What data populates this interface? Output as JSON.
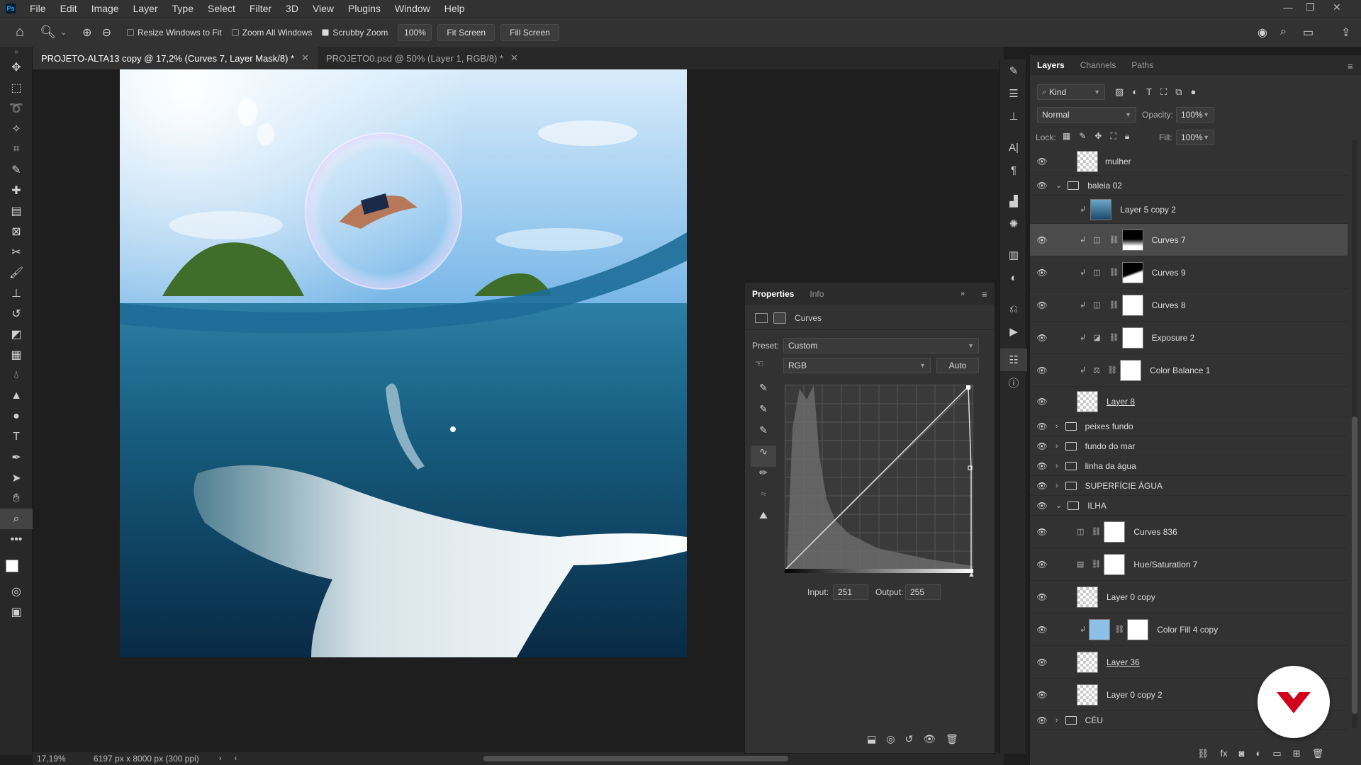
{
  "menu": {
    "app_logo": "Ps",
    "items": [
      "File",
      "Edit",
      "Image",
      "Layer",
      "Type",
      "Select",
      "Filter",
      "3D",
      "View",
      "Plugins",
      "Window",
      "Help"
    ]
  },
  "options": {
    "resize_windows": "Resize Windows to Fit",
    "zoom_all": "Zoom All Windows",
    "scrubby_zoom": "Scrubby Zoom",
    "zoom_value": "100%",
    "fit_screen": "Fit Screen",
    "fill_screen": "Fill Screen"
  },
  "tabs": [
    {
      "label": "PROJETO-ALTA13 copy @ 17,2% (Curves 7, Layer Mask/8) *",
      "active": true
    },
    {
      "label": "PROJETO0.psd @ 50% (Layer 1, RGB/8) *",
      "active": false
    }
  ],
  "status": {
    "zoom": "17,19%",
    "doc_size": "6197 px x 8000 px (300 ppi)"
  },
  "properties": {
    "tab_properties": "Properties",
    "tab_info": "Info",
    "type_label": "Curves",
    "preset_label": "Preset:",
    "preset_value": "Custom",
    "channel_value": "RGB",
    "auto_label": "Auto",
    "input_label": "Input:",
    "input_value": "251",
    "output_label": "Output:",
    "output_value": "255"
  },
  "layers_panel": {
    "tab_layers": "Layers",
    "tab_channels": "Channels",
    "tab_paths": "Paths",
    "filter_kind": "Kind",
    "blend_mode": "Normal",
    "opacity_label": "Opacity:",
    "opacity_value": "100%",
    "lock_label": "Lock:",
    "fill_label": "Fill:",
    "fill_value": "100%",
    "rows": [
      {
        "name": "mulher",
        "kind": "smart",
        "visible": true
      },
      {
        "name": "baleia 02",
        "kind": "group-open",
        "visible": true
      },
      {
        "name": "Layer 5 copy 2",
        "kind": "image-clip",
        "visible": false
      },
      {
        "name": "Curves 7",
        "kind": "adj-curves-clip",
        "visible": true,
        "selected": true
      },
      {
        "name": "Curves 9",
        "kind": "adj-curves-clip",
        "visible": true
      },
      {
        "name": "Curves 8",
        "kind": "adj-curves-clip",
        "visible": true
      },
      {
        "name": "Exposure 2",
        "kind": "adj-exposure-clip",
        "visible": true
      },
      {
        "name": "Color Balance 1",
        "kind": "adj-balance-clip",
        "visible": true
      },
      {
        "name": "Layer 8",
        "kind": "smart",
        "visible": true
      },
      {
        "name": "peixes fundo",
        "kind": "group",
        "visible": true
      },
      {
        "name": "fundo do mar",
        "kind": "group",
        "visible": true
      },
      {
        "name": "linha da água",
        "kind": "group",
        "visible": true
      },
      {
        "name": "SUPERFÍCIE ÁGUA",
        "kind": "group",
        "visible": true
      },
      {
        "name": "ILHA",
        "kind": "group-open",
        "visible": true
      },
      {
        "name": "Curves 836",
        "kind": "adj-curves",
        "visible": true
      },
      {
        "name": "Hue/Saturation 7",
        "kind": "adj-hue",
        "visible": true
      },
      {
        "name": "Layer 0 copy",
        "kind": "smart",
        "visible": true
      },
      {
        "name": "Color Fill 4 copy",
        "kind": "fill-clip",
        "visible": true
      },
      {
        "name": "Layer 36",
        "kind": "smart",
        "visible": true
      },
      {
        "name": "Layer 0 copy 2",
        "kind": "smart",
        "visible": true
      },
      {
        "name": "CÉU",
        "kind": "group",
        "visible": true
      }
    ]
  },
  "colors": {
    "accent_red": "#d0021b",
    "selected_row": "#4b4b4b"
  }
}
